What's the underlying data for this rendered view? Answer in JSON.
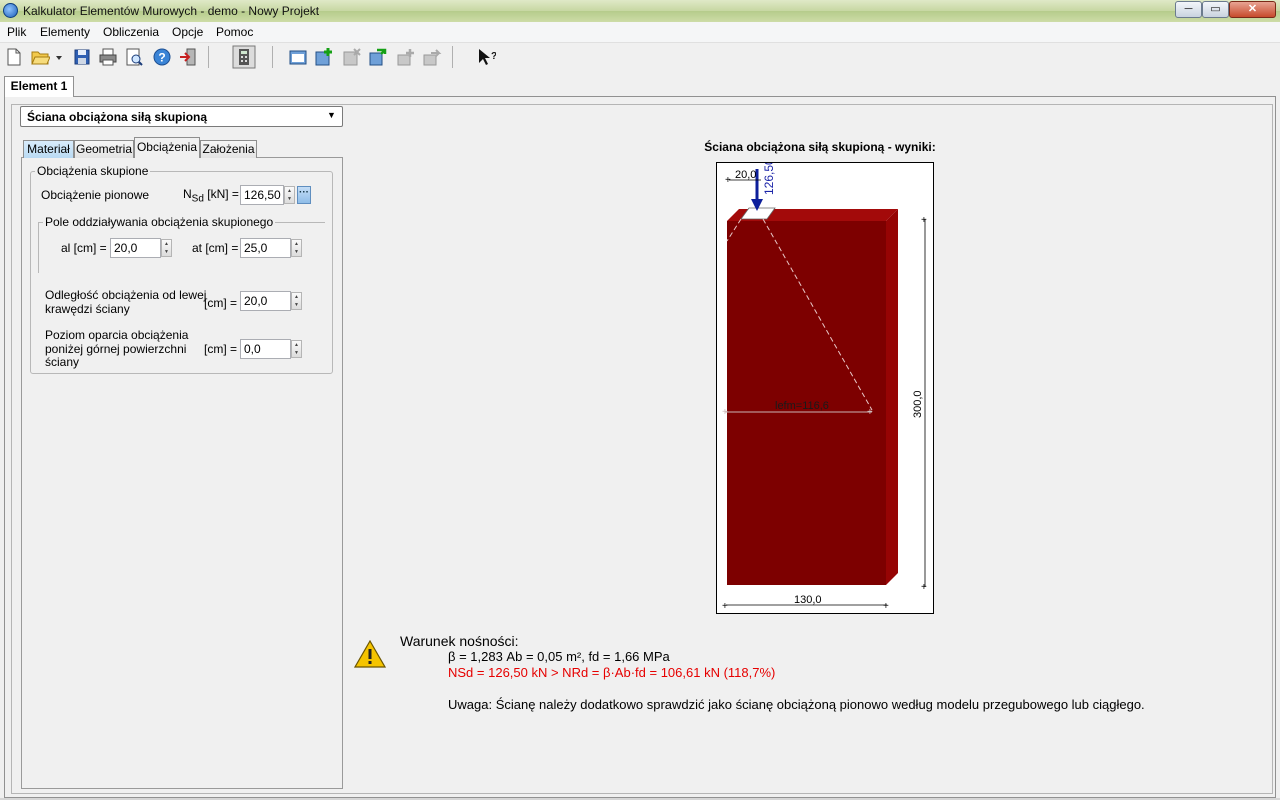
{
  "window": {
    "title": "Kalkulator Elementów Murowych - demo - Nowy Projekt",
    "minimize": "─",
    "maximize": "▭",
    "close": "✕"
  },
  "menu": [
    "Plik",
    "Elementy",
    "Obliczenia",
    "Opcje",
    "Pomoc"
  ],
  "toolbar": [
    "new-document-icon",
    "open-folder-icon",
    "dropdown-arrow-icon",
    "save-icon",
    "print-icon",
    "print-preview-icon",
    "help-icon",
    "exit-icon",
    "calculator-icon",
    "element-list-icon",
    "add-element-icon",
    "delete-element-icon",
    "copy-element-icon",
    "move-up-icon",
    "move-down-icon",
    "context-help-icon"
  ],
  "tabs": {
    "element": "Element 1"
  },
  "element_type": {
    "selected": "Ściana obciążona siłą skupioną"
  },
  "subtabs": [
    "Materiał",
    "Geometria",
    "Obciążenia",
    "Założenia"
  ],
  "loads": {
    "group_title": "Obciążenia skupione",
    "vertical_label": "Obciążenie pionowe",
    "vertical_symbol": "N",
    "vertical_sub": "Sd",
    "vertical_unit": " [kN] =",
    "vertical_value": "126,50",
    "area_group_title": "Pole oddziaływania obciążenia skupionego",
    "al_label": "al [cm] =",
    "al_value": "20,0",
    "at_label": "at [cm] =",
    "at_value": "25,0",
    "distance_label_1": "Odległość obciążenia od lewej",
    "distance_label_2": "krawędzi ściany",
    "distance_unit": "[cm] =",
    "distance_value": "20,0",
    "support_label_1": "Poziom oparcia obciążenia",
    "support_label_2": "poniżej górnej powierzchni",
    "support_label_3": "ściany",
    "support_unit": "[cm] =",
    "support_value": "0,0"
  },
  "results": {
    "title": "Ściana obciążona siłą skupioną - wyniki:",
    "load_value": "126,50",
    "dim_left": "20,0",
    "dim_height": "300,0",
    "dim_width": "130,0",
    "lefm": "lefm=116,6",
    "wall_color": "#7d0000",
    "wall_top_color": "#a30a0a",
    "wall_side_color": "#960404"
  },
  "condition": {
    "title": "Warunek nośności:",
    "line1": "β = 1,283  Ab = 0,05 m²,  fd = 1,66 MPa",
    "line2": "NSd = 126,50 kN  >  NRd = β·Ab·fd = 106,61 kN     (118,7%)",
    "note": "Uwaga: Ścianę należy dodatkowo sprawdzić jako ścianę obciążoną pionowo według modelu przegubowego lub ciągłego."
  }
}
